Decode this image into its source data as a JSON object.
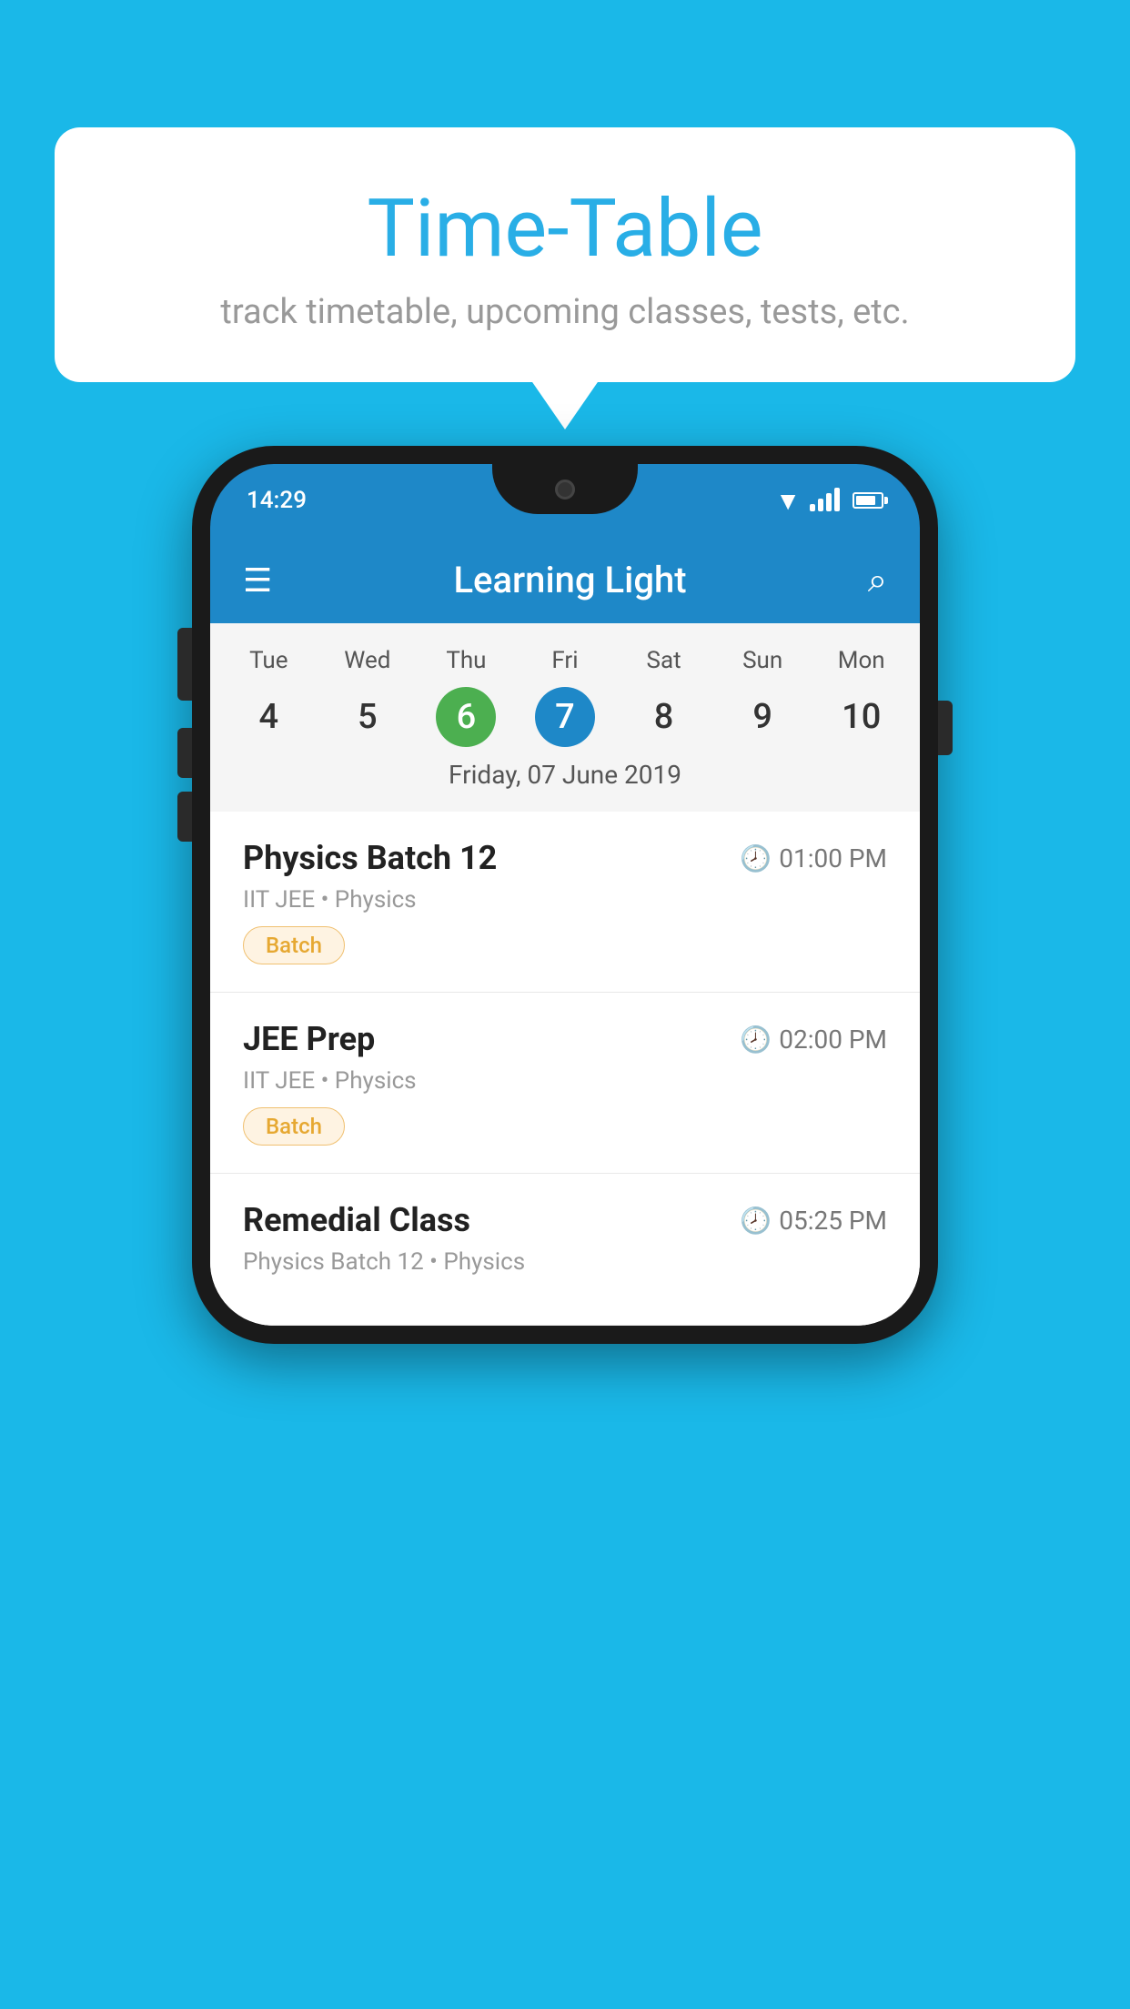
{
  "page": {
    "background_color": "#1ab8e8"
  },
  "speech_bubble": {
    "title": "Time-Table",
    "subtitle": "track timetable, upcoming classes, tests, etc."
  },
  "phone": {
    "status_bar": {
      "time": "14:29"
    },
    "app_bar": {
      "title": "Learning Light",
      "menu_icon": "☰",
      "search_icon": "🔍"
    },
    "calendar": {
      "days": [
        {
          "label": "Tue",
          "number": "4"
        },
        {
          "label": "Wed",
          "number": "5"
        },
        {
          "label": "Thu",
          "number": "6",
          "state": "today"
        },
        {
          "label": "Fri",
          "number": "7",
          "state": "selected"
        },
        {
          "label": "Sat",
          "number": "8"
        },
        {
          "label": "Sun",
          "number": "9"
        },
        {
          "label": "Mon",
          "number": "10"
        }
      ],
      "selected_date_label": "Friday, 07 June 2019"
    },
    "events": [
      {
        "title": "Physics Batch 12",
        "time": "01:00 PM",
        "subtitle": "IIT JEE • Physics",
        "badge": "Batch"
      },
      {
        "title": "JEE Prep",
        "time": "02:00 PM",
        "subtitle": "IIT JEE • Physics",
        "badge": "Batch"
      },
      {
        "title": "Remedial Class",
        "time": "05:25 PM",
        "subtitle": "Physics Batch 12 • Physics",
        "badge": null
      }
    ]
  }
}
